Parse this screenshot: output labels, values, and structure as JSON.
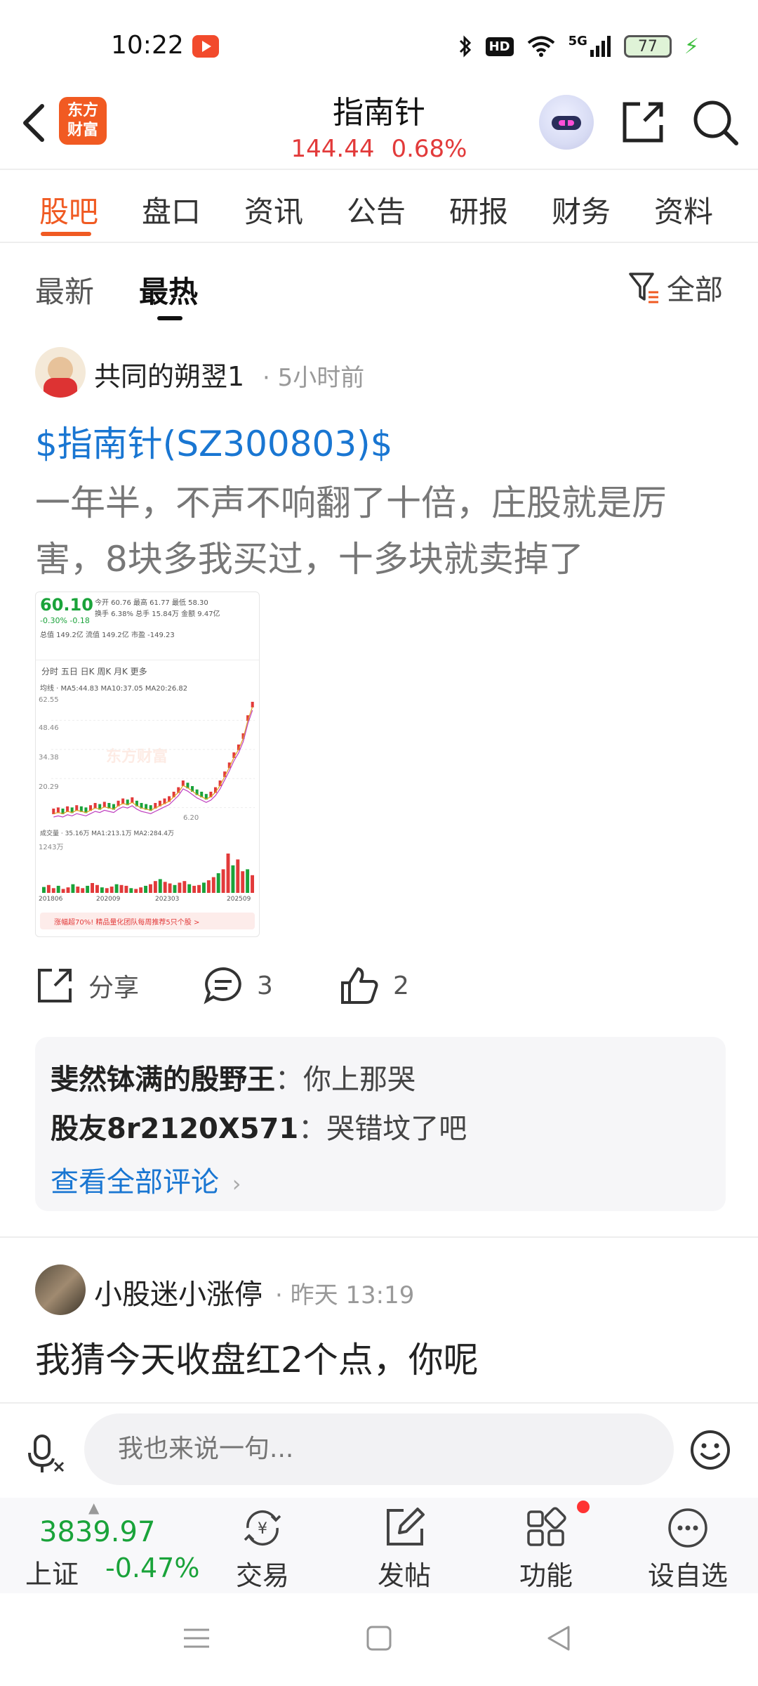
{
  "status_bar": {
    "time": "10:22",
    "hd": "HD",
    "network": "5G",
    "battery": "77"
  },
  "header": {
    "logo_text": "东方财富",
    "title": "指南针",
    "price": "144.44",
    "change_pct": "0.68%"
  },
  "tabs": [
    {
      "label": "股吧"
    },
    {
      "label": "盘口"
    },
    {
      "label": "资讯"
    },
    {
      "label": "公告"
    },
    {
      "label": "研报"
    },
    {
      "label": "财务"
    },
    {
      "label": "资料"
    }
  ],
  "subtabs": [
    {
      "label": "最新"
    },
    {
      "label": "最热"
    }
  ],
  "filter_label": "全部",
  "post1": {
    "author": "共同的朔翌1",
    "time": "· 5小时前",
    "stock_link": "$指南针(SZ300803)$",
    "body": "一年半，不声不响翻了十倍，庄股就是厉害，8块多我买过，十多块就卖掉了",
    "thumbnail": {
      "price": "60.10",
      "change": "-0.30%  -0.18",
      "row1": "今开  60.76  最高  61.77  最低  58.30",
      "row2": "换手  6.38%  总手 15.84万  金额 9.47亿",
      "row3": "总值 149.2亿  流值 149.2亿  市盈 -149.23",
      "tabs": "分时  五日  日K  周K  月K  更多",
      "ma": "均线 · MA5:44.83 MA10:37.05 MA20:26.82",
      "y_top": "62.55",
      "y2": "48.46",
      "y3": "34.38",
      "y4": "20.29",
      "y5": "6.20",
      "vol_label": "成交量 · 35.16万  MA1:213.1万  MA2:284.4万",
      "vol_top": "1243万",
      "dates": [
        "201806",
        "202009",
        "202303",
        "202509"
      ],
      "ad": "涨幅超70%! 精品量化团队每周推荐5只个股 >",
      "watermark": "东方财富",
      "rise": [
        0.05,
        0.06,
        0.05,
        0.07,
        0.06,
        0.08,
        0.07,
        0.06,
        0.08,
        0.1,
        0.09,
        0.11,
        0.1,
        0.09,
        0.12,
        0.14,
        0.13,
        0.15,
        0.12,
        0.1,
        0.09,
        0.08,
        0.1,
        0.12,
        0.14,
        0.16,
        0.2,
        0.24,
        0.3,
        0.28,
        0.25,
        0.22,
        0.2,
        0.18,
        0.2,
        0.24,
        0.3,
        0.38,
        0.46,
        0.55,
        0.62,
        0.72,
        0.88,
        1.0
      ],
      "vols": [
        0.15,
        0.2,
        0.12,
        0.18,
        0.1,
        0.14,
        0.22,
        0.16,
        0.12,
        0.18,
        0.25,
        0.2,
        0.14,
        0.12,
        0.16,
        0.22,
        0.2,
        0.18,
        0.12,
        0.1,
        0.14,
        0.18,
        0.22,
        0.3,
        0.35,
        0.28,
        0.24,
        0.2,
        0.26,
        0.3,
        0.22,
        0.18,
        0.2,
        0.26,
        0.32,
        0.4,
        0.5,
        0.6,
        1.0,
        0.7,
        0.85,
        0.55,
        0.6,
        0.45
      ]
    },
    "share_label": "分享",
    "comment_count": "3",
    "like_count": "2"
  },
  "comments": [
    {
      "user": "斐然钵满的殷野王",
      "text": "：你上那哭"
    },
    {
      "user": "股友8r2120X571",
      "text": "：哭错坟了吧"
    }
  ],
  "view_all": "查看全部评论",
  "post2": {
    "author": "小股迷小涨停",
    "time": "· 昨天 13:19",
    "body": "我猜今天收盘红2个点，你呢"
  },
  "input_placeholder": "我也来说一句...",
  "bottom_nav": {
    "index_value": "3839.97",
    "index_name": "上证",
    "index_change": "-0.47%",
    "items": [
      {
        "label": "交易"
      },
      {
        "label": "发帖"
      },
      {
        "label": "功能"
      },
      {
        "label": "设自选"
      }
    ]
  },
  "colors": {
    "accent": "#f05a22",
    "up": "#e23a3a",
    "down": "#1aa33a",
    "link": "#1976d2"
  }
}
